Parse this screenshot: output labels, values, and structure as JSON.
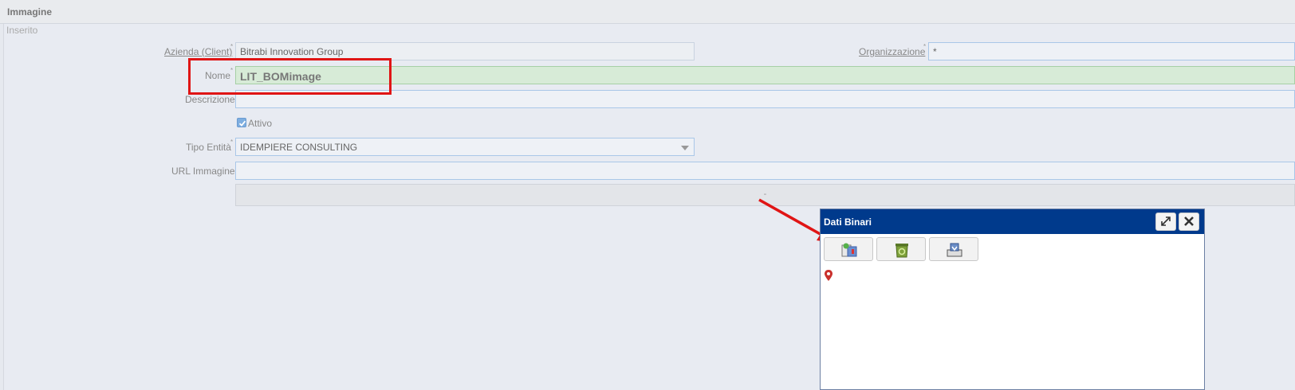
{
  "panel": {
    "title": "Immagine"
  },
  "status": "Inserito",
  "form": {
    "client": {
      "label": "Azienda (Client)",
      "value": "Bitrabi Innovation Group"
    },
    "organization": {
      "label": "Organizzazione",
      "value": "*"
    },
    "name": {
      "label": "Nome",
      "value": "LIT_BOMimage"
    },
    "description": {
      "label": "Descrizione",
      "value": ""
    },
    "active": {
      "label": "Attivo",
      "checked": true
    },
    "entity_type": {
      "label": "Tipo Entità",
      "value": "IDEMPIERE CONSULTING"
    },
    "image_url": {
      "label": "URL Immagine",
      "value": ""
    },
    "image_placeholder": "-"
  },
  "dialog": {
    "title": "Dati Binari",
    "buttons": [
      "upload-icon",
      "delete-icon",
      "save-icon"
    ],
    "window_controls": [
      "maximize-icon",
      "close-icon"
    ]
  },
  "annotations": {
    "color": "#e01515"
  }
}
